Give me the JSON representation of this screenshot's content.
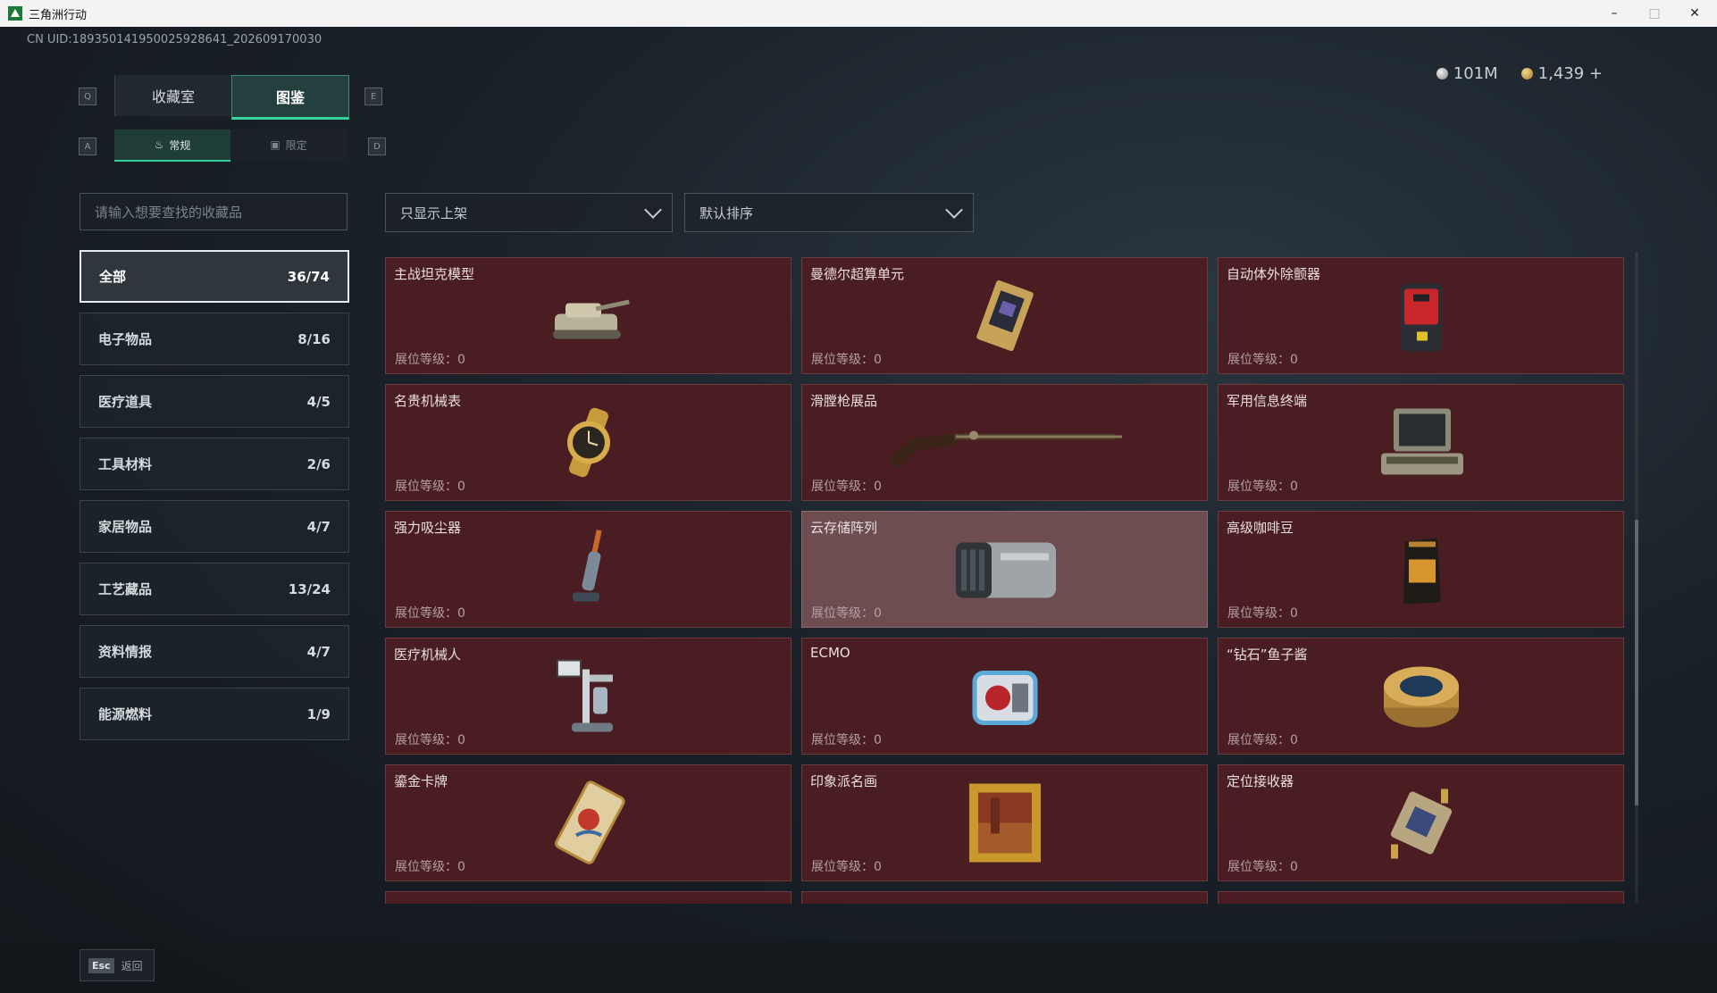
{
  "window": {
    "title": "三角洲行动",
    "controls": [
      "–",
      "□",
      "✕"
    ]
  },
  "uid": "CN UID:18935014195002592864​1_202609170030",
  "currency": {
    "silver": "101M",
    "gold": "1,439",
    "add": "+"
  },
  "keys": {
    "q": "Q",
    "e": "E",
    "a": "A",
    "d": "D"
  },
  "main_tabs": [
    {
      "label": "收藏室"
    },
    {
      "label": "图鉴"
    }
  ],
  "sub_tabs": [
    {
      "label": "常规"
    },
    {
      "label": "限定"
    }
  ],
  "search": {
    "placeholder": "请输入想要查找的收藏品"
  },
  "filter": {
    "value": "只显示上架"
  },
  "sort": {
    "value": "默认排序"
  },
  "categories": [
    {
      "label": "全部",
      "count": "36/74"
    },
    {
      "label": "电子物品",
      "count": "8/16"
    },
    {
      "label": "医疗道具",
      "count": "4/5"
    },
    {
      "label": "工具材料",
      "count": "2/6"
    },
    {
      "label": "家居物品",
      "count": "4/7"
    },
    {
      "label": "工艺藏品",
      "count": "13/24"
    },
    {
      "label": "资料情报",
      "count": "4/7"
    },
    {
      "label": "能源燃料",
      "count": "1/9"
    }
  ],
  "level_label": "展位等级：0",
  "items": [
    {
      "name": "主战坦克模型",
      "icon": "tank-icon"
    },
    {
      "name": "曼德尔超算单元",
      "icon": "supercomputer-icon"
    },
    {
      "name": "自动体外除颤器",
      "icon": "defibrillator-icon"
    },
    {
      "name": "名贵机械表",
      "icon": "watch-icon"
    },
    {
      "name": "滑膛枪展品",
      "icon": "musket-icon"
    },
    {
      "name": "军用信息终端",
      "icon": "terminal-icon"
    },
    {
      "name": "强力吸尘器",
      "icon": "vacuum-icon"
    },
    {
      "name": "云存储阵列",
      "icon": "storage-icon"
    },
    {
      "name": "高级咖啡豆",
      "icon": "coffee-icon"
    },
    {
      "name": "医疗机械人",
      "icon": "medical-robot-icon"
    },
    {
      "name": "ECMO",
      "icon": "ecmo-icon"
    },
    {
      "name": "“钻石”鱼子酱",
      "icon": "caviar-icon"
    },
    {
      "name": "鎏金卡牌",
      "icon": "card-icon"
    },
    {
      "name": "印象派名画",
      "icon": "painting-icon"
    },
    {
      "name": "定位接收器",
      "icon": "receiver-icon"
    }
  ],
  "esc": {
    "key": "Esc",
    "label": "返回"
  }
}
